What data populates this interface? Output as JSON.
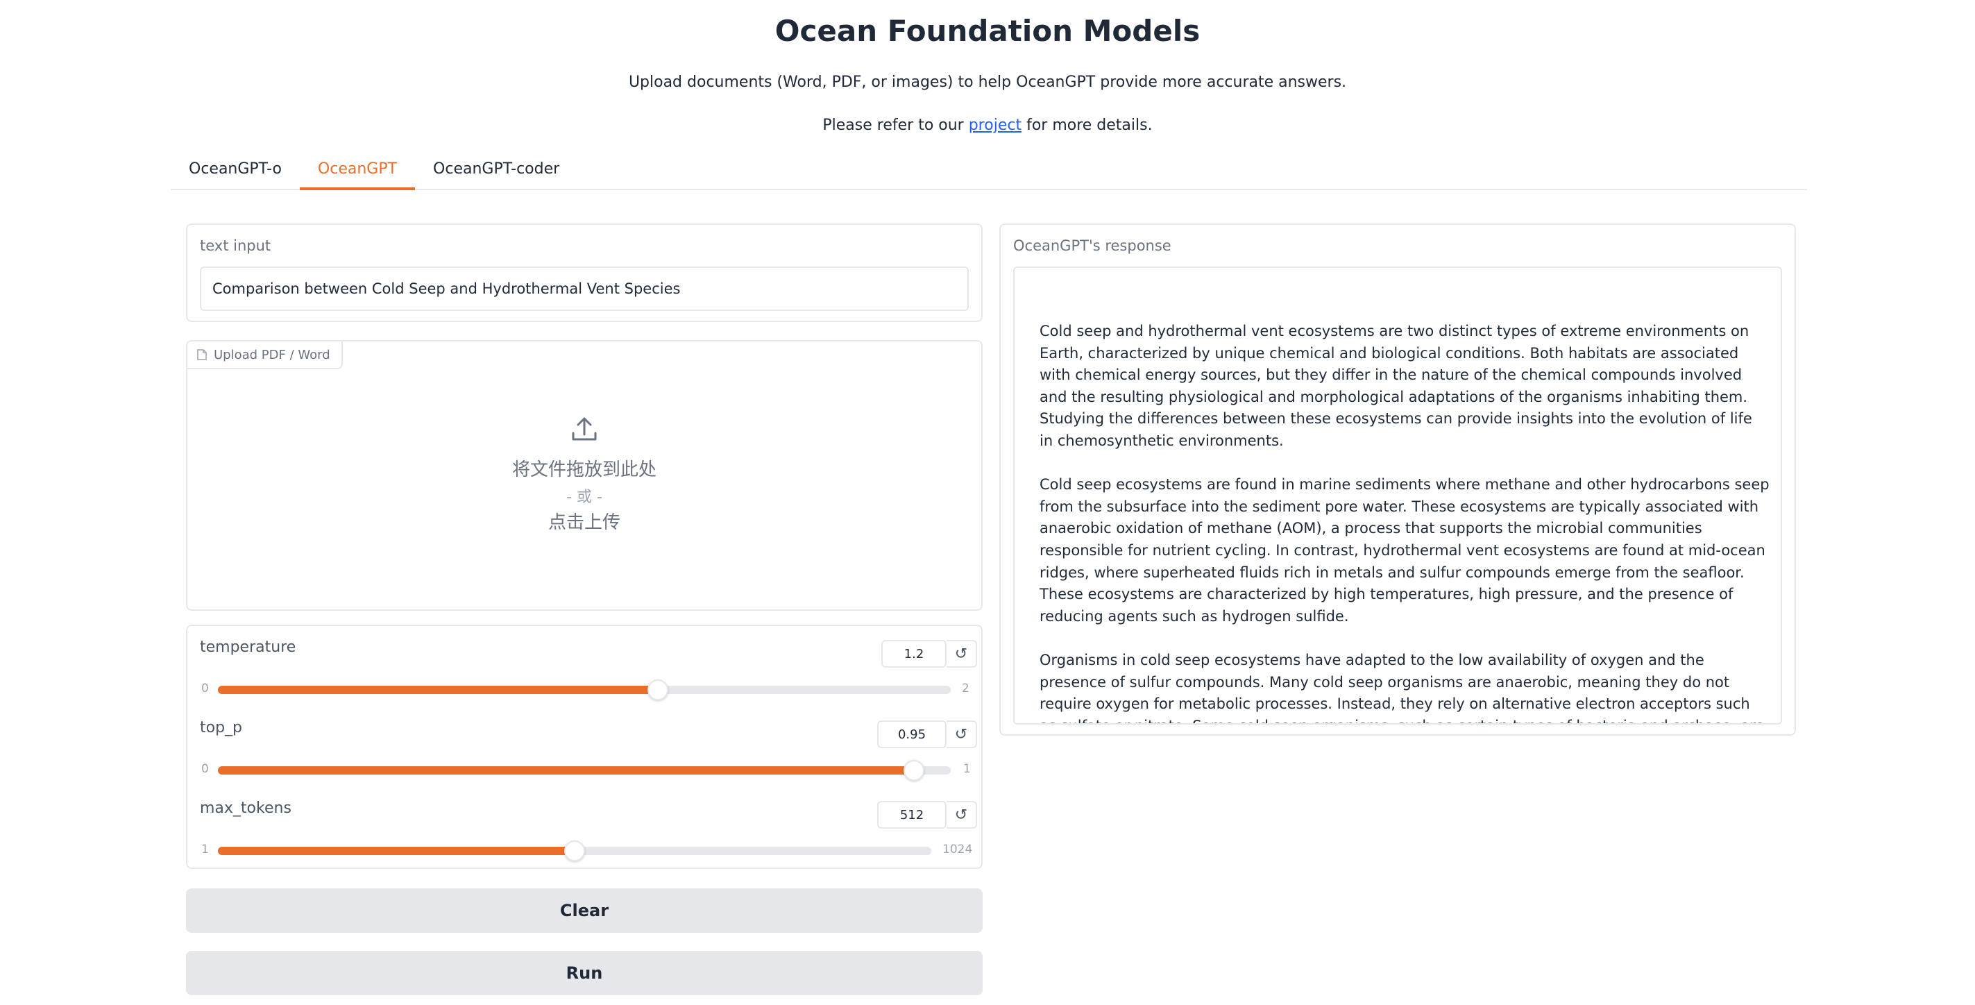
{
  "header": {
    "title": "Ocean Foundation Models",
    "subtitle": "Upload documents (Word, PDF, or images) to help OceanGPT provide more accurate answers.",
    "ref_prefix": "Please refer to our",
    "ref_link": "project",
    "ref_suffix": "for more details."
  },
  "tabs": [
    {
      "label": "OceanGPT-o",
      "active": false
    },
    {
      "label": "OceanGPT",
      "active": true
    },
    {
      "label": "OceanGPT-coder",
      "active": false
    }
  ],
  "text_input": {
    "label": "text input",
    "value": "Comparison between Cold Seep and Hydrothermal Vent Species"
  },
  "upload": {
    "tag_label": "Upload PDF / Word",
    "drop_text": "将文件拖放到此处",
    "or_text": "- 或 -",
    "click_text": "点击上传",
    "icon": "upload-icon"
  },
  "sliders": [
    {
      "label": "temperature",
      "value": "1.2",
      "min": "0",
      "max": "2",
      "fraction": 0.6
    },
    {
      "label": "top_p",
      "value": "0.95",
      "min": "0",
      "max": "1",
      "fraction": 0.95
    },
    {
      "label": "max_tokens",
      "value": "512",
      "min": "1",
      "max": "1024",
      "fraction": 0.5
    }
  ],
  "buttons": {
    "clear": "Clear",
    "run": "Run"
  },
  "response": {
    "label": "OceanGPT's response",
    "paragraphs": [
      "Cold seep and hydrothermal vent ecosystems are two distinct types of extreme environments on Earth, characterized by unique chemical and biological conditions. Both habitats are associated with chemical energy sources, but they differ in the nature of the chemical compounds involved and the resulting physiological and morphological adaptations of the organisms inhabiting them. Studying the differences between these ecosystems can provide insights into the evolution of life in chemosynthetic environments.",
      "Cold seep ecosystems are found in marine sediments where methane and other hydrocarbons seep from the subsurface into the sediment pore water. These ecosystems are typically associated with anaerobic oxidation of methane (AOM), a process that supports the microbial communities responsible for nutrient cycling. In contrast, hydrothermal vent ecosystems are found at mid-ocean ridges, where superheated fluids rich in metals and sulfur compounds emerge from the seafloor. These ecosystems are characterized by high temperatures, high pressure, and the presence of reducing agents such as hydrogen sulfide.",
      "Organisms in cold seep ecosystems have adapted to the low availability of oxygen and the presence of sulfur compounds. Many cold seep organisms are anaerobic, meaning they do not require oxygen for metabolic processes. Instead, they rely on alternative electron acceptors such as sulfate or nitrate. Some cold seep organisms, such as certain types of bacteria and archaea, are involved in the anaerobic oxidation of methane, a process that is crucial for the functioning of cold seep ecosystems."
    ]
  },
  "colors": {
    "accent": "#ea6d2a",
    "link": "#2563eb",
    "border": "#e5e7eb",
    "button_bg": "#e5e7eb"
  }
}
